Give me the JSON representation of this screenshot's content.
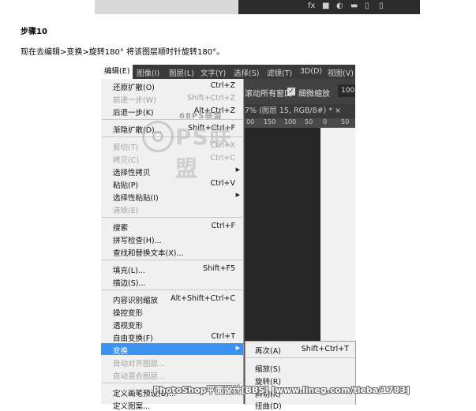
{
  "top_strip": {
    "icons": [
      "fx",
      "■",
      "◐",
      "▬",
      "▯",
      "▯"
    ]
  },
  "article": {
    "step_title": "步骤10",
    "instruction": "现在去编辑>变换>旋转180° 将该图层顺时针旋转180°。"
  },
  "menubar": {
    "items": [
      "编辑(E)",
      "图像(I)",
      "图层(L)",
      "文字(Y)",
      "选择(S)",
      "滤镜(T)",
      "3D(D)",
      "视图(V)"
    ]
  },
  "options_bar": {
    "left_text": "滚动所有窗口",
    "checkbox_checked": true,
    "checkbox_label": "细微缩放",
    "zoom_value": "100"
  },
  "document_tab": {
    "title": "7% (图层 15, RGB/8#) *",
    "close": "×"
  },
  "ruler": {
    "ticks": [
      "00",
      "150",
      "100",
      "50",
      "0",
      "50"
    ]
  },
  "edit_menu": {
    "items": [
      {
        "label": "还原扩散(O)",
        "shortcut": "Ctrl+Z",
        "disabled": false
      },
      {
        "label": "前进一步(W)",
        "shortcut": "Shift+Ctrl+Z",
        "disabled": true
      },
      {
        "label": "后退一步(K)",
        "shortcut": "Alt+Ctrl+Z",
        "disabled": false
      },
      {
        "label": "渐隐扩散(D)...",
        "shortcut": "Shift+Ctrl+F",
        "disabled": false
      },
      {
        "label": "剪切(T)",
        "shortcut": "Ctrl+X",
        "disabled": true
      },
      {
        "label": "拷贝(C)",
        "shortcut": "Ctrl+C",
        "disabled": true
      },
      {
        "label": "选择性拷贝",
        "shortcut": "",
        "disabled": false,
        "submenu": true
      },
      {
        "label": "粘贴(P)",
        "shortcut": "Ctrl+V",
        "disabled": false
      },
      {
        "label": "选择性粘贴(I)",
        "shortcut": "",
        "disabled": false,
        "submenu": true
      },
      {
        "label": "清除(E)",
        "shortcut": "",
        "disabled": true
      },
      {
        "label": "搜索",
        "shortcut": "Ctrl+F",
        "disabled": false
      },
      {
        "label": "拼写检查(H)...",
        "shortcut": "",
        "disabled": false
      },
      {
        "label": "查找和替换文本(X)...",
        "shortcut": "",
        "disabled": false
      },
      {
        "label": "填充(L)...",
        "shortcut": "Shift+F5",
        "disabled": false
      },
      {
        "label": "描边(S)...",
        "shortcut": "",
        "disabled": false
      },
      {
        "label": "内容识别缩放",
        "shortcut": "Alt+Shift+Ctrl+C",
        "disabled": false
      },
      {
        "label": "操控变形",
        "shortcut": "",
        "disabled": false
      },
      {
        "label": "透视变形",
        "shortcut": "",
        "disabled": false
      },
      {
        "label": "自由变换(F)",
        "shortcut": "Ctrl+T",
        "disabled": false
      },
      {
        "label": "变换",
        "shortcut": "",
        "disabled": false,
        "submenu": true,
        "highlighted": true
      },
      {
        "label": "自动对齐图层...",
        "shortcut": "",
        "disabled": true
      },
      {
        "label": "自动混合图层...",
        "shortcut": "",
        "disabled": true
      },
      {
        "label": "定义画笔预设(B)...",
        "shortcut": "",
        "disabled": false
      },
      {
        "label": "定义图案...",
        "shortcut": "",
        "disabled": false
      }
    ]
  },
  "transform_submenu": {
    "items": [
      {
        "label": "再次(A)",
        "shortcut": "Shift+Ctrl+T"
      },
      {
        "label": "缩放(S)",
        "shortcut": ""
      },
      {
        "label": "旋转(R)",
        "shortcut": ""
      },
      {
        "label": "斜切(K)",
        "shortcut": ""
      },
      {
        "label": "扭曲(D)",
        "shortcut": ""
      }
    ]
  },
  "watermark": {
    "site": "68PS联盟",
    "big": "PS联盟"
  },
  "footer_watermark": "PhotoShop平面设计[BBS] [www.lineg.com/tieba/1783]"
}
